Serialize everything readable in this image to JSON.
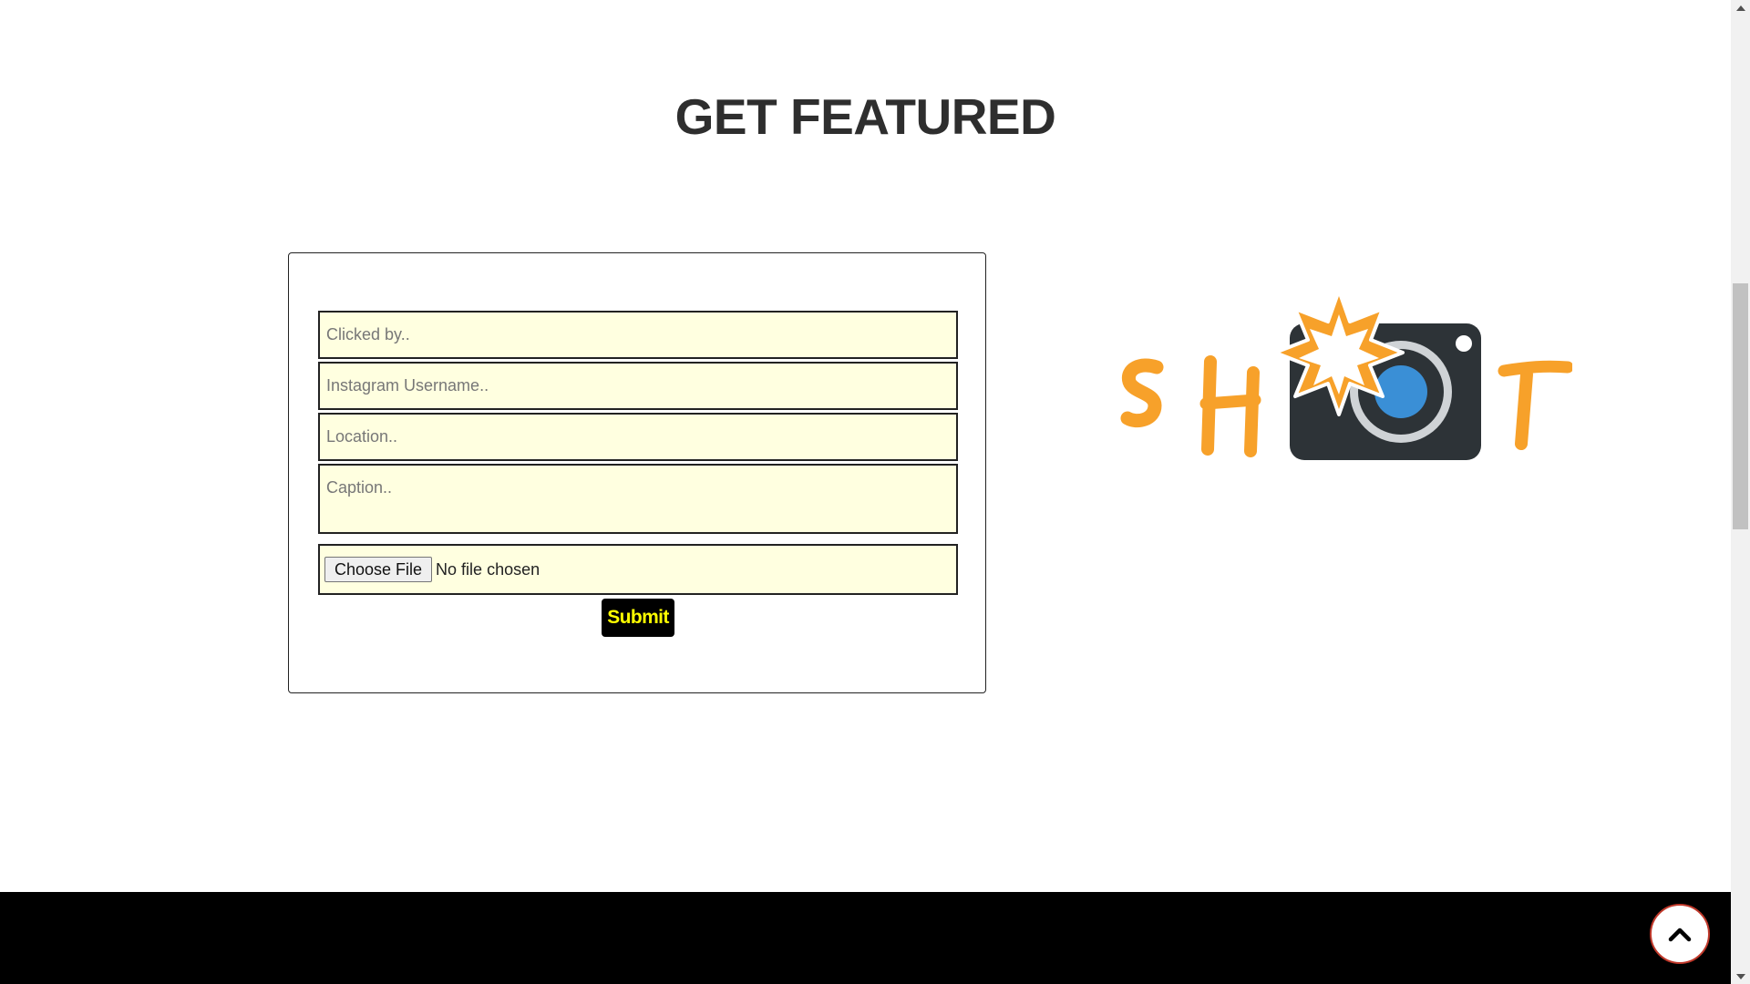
{
  "section": {
    "title": "GET FEATURED"
  },
  "form": {
    "clicked_by_placeholder": "Clicked by..",
    "instagram_placeholder": "Instagram Username..",
    "location_placeholder": "Location..",
    "caption_placeholder": "Caption..",
    "file_button_label": "Choose File",
    "file_status": "No file chosen",
    "submit_label": "Submit"
  },
  "logo": {
    "text": "SHOT",
    "accent_color": "#f7a12a",
    "camera_color": "#2d3337",
    "lens_color": "#3a8fd6"
  },
  "colors": {
    "field_background": "#ffffe0",
    "submit_background": "#000000",
    "submit_text": "#ffff00",
    "footer": "#000000"
  },
  "icons": {
    "back_to_top": "chevron-up-icon"
  }
}
